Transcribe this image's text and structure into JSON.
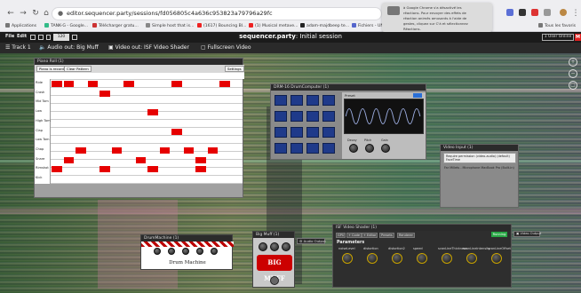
{
  "browser": {
    "url": "editor.sequencer.party/sessions/fd056805c4a636c953823a79796a29fc",
    "bookmarks": [
      "Applications",
      "TANK-G - Google...",
      "Télécharger gratu...",
      "Simple host that is...",
      "(1617) Bouncing Bl...",
      "(1) Musical metave...",
      "adam-majdbeep te...",
      "Fichiers - UN",
      "Tous les favoris"
    ],
    "tooltip": [
      "à Google Chrome s'a désactivé les",
      "réactions. Pour envoyer des effets de",
      "réaction animés amusants à l'aide de",
      "gestes, cliquez sur C'à et sélectionnez",
      "Réactions."
    ]
  },
  "appbar": {
    "file": "File",
    "edit": "Edit",
    "bpm": "120",
    "title_bold": "sequencer.party",
    "title_rest": ": Initial session",
    "user": "1 User Online",
    "logo": "M"
  },
  "trackbar": {
    "track": "Track 1",
    "audio_out": "Audio out: Big Muff",
    "video_out": "Video out: ISF Video Shader",
    "fullscreen": "Fullscreen Video"
  },
  "piano": {
    "title": "Piano Roll (1)",
    "btn_record": "Piano is record",
    "btn_clear": "Clear Pattern",
    "btn_settings": "Settings",
    "rows": [
      "Ride",
      "Crash",
      "Mid Tom",
      "Low",
      "High Tom",
      "Clap",
      "Low Tom",
      "Chap",
      "Snare",
      "Rimshot",
      "Kick"
    ],
    "notes": [
      {
        "row": 0,
        "col": 0
      },
      {
        "row": 0,
        "col": 1
      },
      {
        "row": 0,
        "col": 3
      },
      {
        "row": 0,
        "col": 6
      },
      {
        "row": 0,
        "col": 10
      },
      {
        "row": 0,
        "col": 14
      },
      {
        "row": 1,
        "col": 4
      },
      {
        "row": 3,
        "col": 8
      },
      {
        "row": 5,
        "col": 10
      },
      {
        "row": 7,
        "col": 2
      },
      {
        "row": 7,
        "col": 5
      },
      {
        "row": 7,
        "col": 9
      },
      {
        "row": 7,
        "col": 11
      },
      {
        "row": 7,
        "col": 13
      },
      {
        "row": 8,
        "col": 1
      },
      {
        "row": 8,
        "col": 7
      },
      {
        "row": 8,
        "col": 12
      },
      {
        "row": 9,
        "col": 0
      },
      {
        "row": 9,
        "col": 4
      },
      {
        "row": 9,
        "col": 8
      },
      {
        "row": 9,
        "col": 12
      }
    ]
  },
  "drum": {
    "title": "DRM-16 DrumComputer (1)",
    "preset": "Preset",
    "knob_labels": [
      "Decay",
      "Pitch",
      "Gain"
    ]
  },
  "video_input": {
    "title": "Video Input (1)",
    "line1": "Require permission (video-audio) (default)",
    "line2": "FaceTime",
    "line3": "Far Millets - Microphone MacBook Pro (Built-in)"
  },
  "machine": {
    "title": "DrumMachine (1)",
    "name": "Drum Machine"
  },
  "muff": {
    "title": "Big Muff (1)",
    "logo": "BIG MUFF",
    "audio_output": "Audio Output"
  },
  "isf": {
    "title": "ISF Video Shader (1)",
    "tools": [
      "GPU",
      "+ Code",
      "+ Editor",
      "Presets",
      "Renderer"
    ],
    "running": "Running",
    "video_output": "Video Output",
    "params_heading": "Parameters",
    "params": [
      "noiseLevel",
      "distortion",
      "distortion2",
      "speed",
      "scanLineThickness",
      "scanLineIntensity",
      "scanLineOffset"
    ]
  },
  "colors": {
    "note": "#e60000",
    "pad": "#1f3a8a",
    "running": "#28a745"
  }
}
